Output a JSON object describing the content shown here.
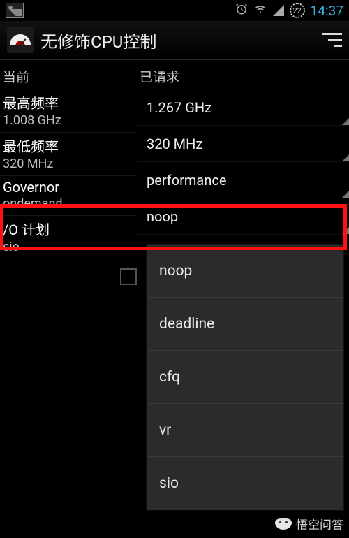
{
  "status": {
    "rotation_badge": "22",
    "time": "14:37"
  },
  "app": {
    "title": "无修饰CPU控制"
  },
  "columns": {
    "left_header": "当前",
    "right_header": "已请求"
  },
  "rows": {
    "max_freq": {
      "label": "最高频率",
      "current": "1.008 GHz",
      "requested": "1.267 GHz"
    },
    "min_freq": {
      "label": "最低频率",
      "current": "320 MHz",
      "requested": "320 MHz"
    },
    "governor": {
      "label": "Governor",
      "current": "ondemand",
      "requested": "performance"
    },
    "io_sched": {
      "label": "/O 计划",
      "current": "sio",
      "requested": "noop"
    }
  },
  "dropdown": {
    "items": [
      "noop",
      "deadline",
      "cfq",
      "vr",
      "sio"
    ]
  },
  "watermark": "悟空问答"
}
